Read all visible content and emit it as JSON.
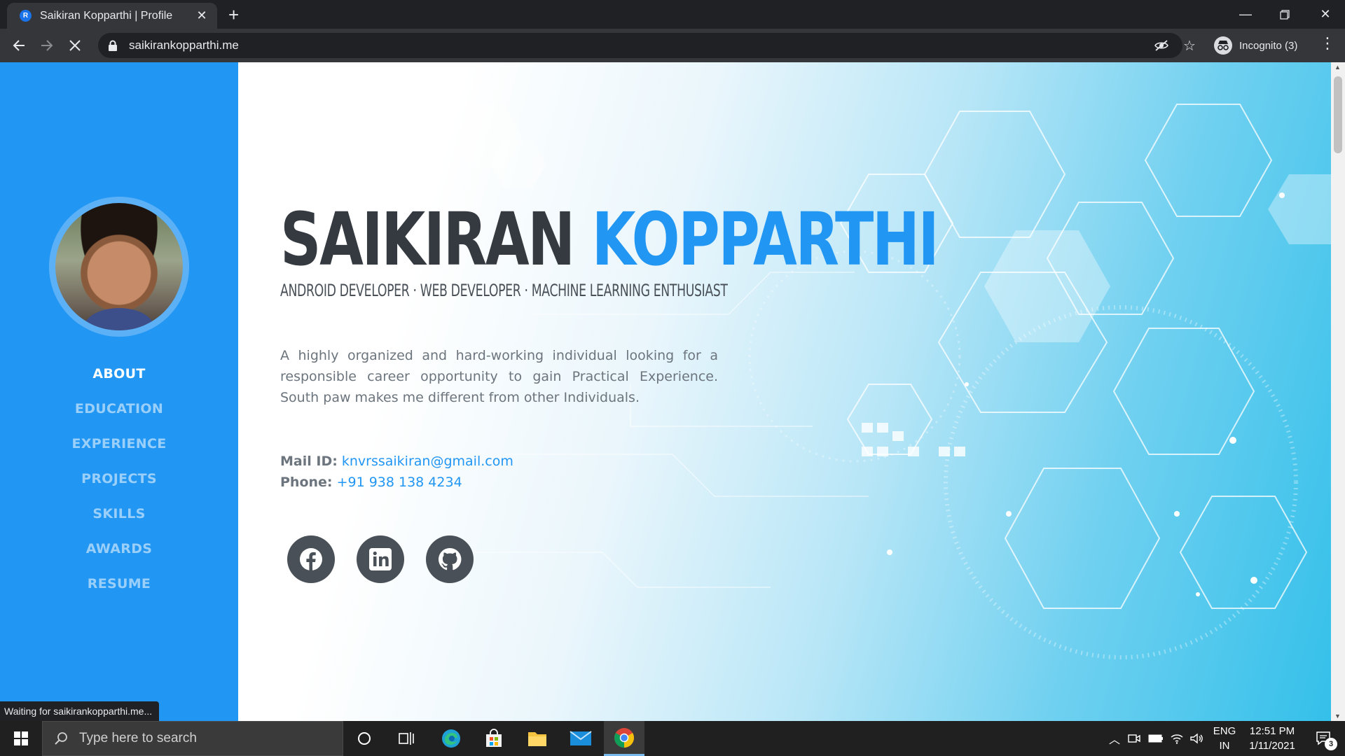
{
  "browser": {
    "tab_title": "Saikiran Kopparthi | Profile",
    "tab_favicon_letter": "R",
    "url": "saikirankopparthi.me",
    "profile_label": "Incognito (3)",
    "status_text": "Waiting for saikirankopparthi.me..."
  },
  "sidebar": {
    "nav": [
      "ABOUT",
      "EDUCATION",
      "EXPERIENCE",
      "PROJECTS",
      "SKILLS",
      "AWARDS",
      "RESUME"
    ],
    "active": "ABOUT"
  },
  "profile": {
    "first_name": "SAIKIRAN",
    "last_name": "KOPPARTHI",
    "subheading": "ANDROID DEVELOPER · WEB DEVELOPER · MACHINE LEARNING ENTHUSIAST",
    "about": "A highly organized and hard-working individual looking for a responsible career opportunity to gain Practical Experience. South paw makes me different from other Individuals.",
    "mail_label": "Mail ID:",
    "mail_value": "knvrssaikiran@gmail.com",
    "phone_label": "Phone:",
    "phone_value": "+91 938 138 4234",
    "socials": [
      "facebook-icon",
      "linkedin-icon",
      "github-icon"
    ]
  },
  "taskbar": {
    "search_placeholder": "Type here to search",
    "lang_line1": "ENG",
    "lang_line2": "IN",
    "time": "12:51 PM",
    "date": "1/11/2021",
    "notification_count": "3"
  },
  "colors": {
    "accent": "#2196f3",
    "heading": "#343a40",
    "chrome_dark": "#202124",
    "chrome_toolbar": "#35363a"
  }
}
